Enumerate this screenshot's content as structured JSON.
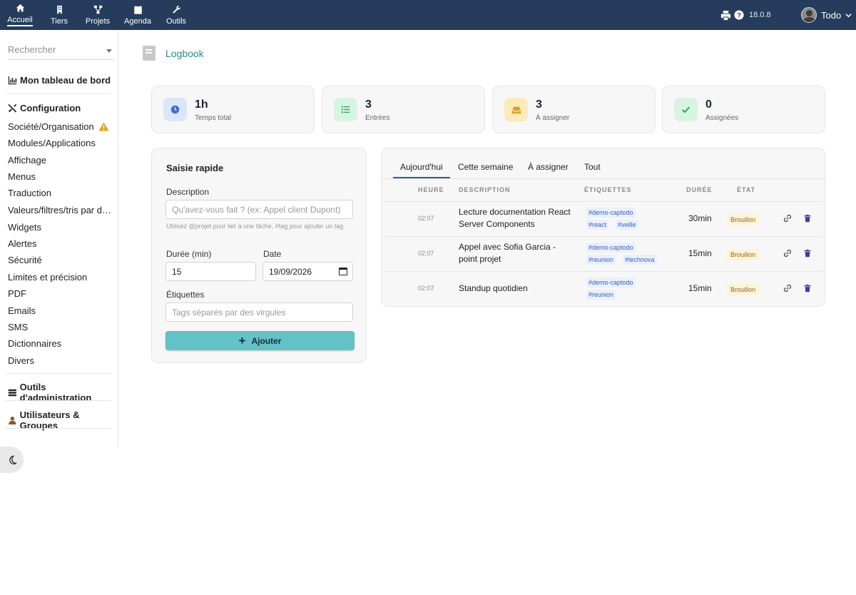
{
  "nav": {
    "items": [
      {
        "label": "Accueil",
        "icon": "home-icon",
        "active": true
      },
      {
        "label": "Tiers",
        "icon": "building-icon"
      },
      {
        "label": "Projets",
        "icon": "project-tree-icon"
      },
      {
        "label": "Agenda",
        "icon": "calendar-icon"
      },
      {
        "label": "Outils",
        "icon": "wrench-icon"
      }
    ],
    "version": "18.0.8",
    "user": "Todo"
  },
  "sidebar": {
    "search_placeholder": "Rechercher",
    "dashboard": "Mon tableau de bord",
    "config_title": "Configuration",
    "config_items": [
      "Société/Organisation",
      "Modules/Applications",
      "Affichage",
      "Menus",
      "Traduction",
      "Valeurs/filtres/tris par défaut",
      "Widgets",
      "Alertes",
      "Sécurité",
      "Limites et précision",
      "PDF",
      "Emails",
      "SMS",
      "Dictionnaires",
      "Divers"
    ],
    "admin_tools": "Outils d'administration",
    "users_groups": "Utilisateurs & Groupes"
  },
  "breadcrumb": "Logbook",
  "stats": [
    {
      "value": "1h",
      "label": "Temps total",
      "icon": "clock-icon",
      "color": "#3b6ad8",
      "bg": "#dbe6fb"
    },
    {
      "value": "3",
      "label": "Entrées",
      "icon": "list-icon",
      "color": "#2fa35a",
      "bg": "#d9f3e2"
    },
    {
      "value": "3",
      "label": "À assigner",
      "icon": "inbox-icon",
      "color": "#e0a119",
      "bg": "#fdeab9"
    },
    {
      "value": "0",
      "label": "Assignées",
      "icon": "check-icon",
      "color": "#2fa35a",
      "bg": "#d9f3e2"
    }
  ],
  "quick": {
    "title": "Saisie rapide",
    "description_label": "Description",
    "description_placeholder": "Qu'avez-vous fait ? (ex: Appel client Dupont)",
    "help": "Utilisez @projet pour lier à une tâche, #tag pour ajouter un tag",
    "duration_label": "Durée (min)",
    "duration_value": "15",
    "date_label": "Date",
    "date_value": "19/09/2026",
    "tags_label": "Étiquettes",
    "tags_placeholder": "Tags séparés par des virgules",
    "add_label": "Ajouter"
  },
  "tabs": [
    "Aujourd'hui",
    "Cette semaine",
    "À assigner",
    "Tout"
  ],
  "table": {
    "headers": {
      "time": "HEURE",
      "description": "DESCRIPTION",
      "tags": "ÉTIQUETTES",
      "duration": "DURÉE",
      "status": "ÉTAT"
    },
    "rows": [
      {
        "time": "02:07",
        "description": "Lecture documentation React Server Components",
        "tags": [
          "#demo-captodo",
          "#react",
          "#veille"
        ],
        "duration": "30min",
        "status": "Brouillon"
      },
      {
        "time": "02:07",
        "description": "Appel avec Sofia Garcia - point projet",
        "tags": [
          "#demo-captodo",
          "#reunion",
          "#technova"
        ],
        "duration": "15min",
        "status": "Brouillon"
      },
      {
        "time": "02:07",
        "description": "Standup quotidien",
        "tags": [
          "#demo-captodo",
          "#reunion"
        ],
        "duration": "15min",
        "status": "Brouillon"
      }
    ]
  }
}
